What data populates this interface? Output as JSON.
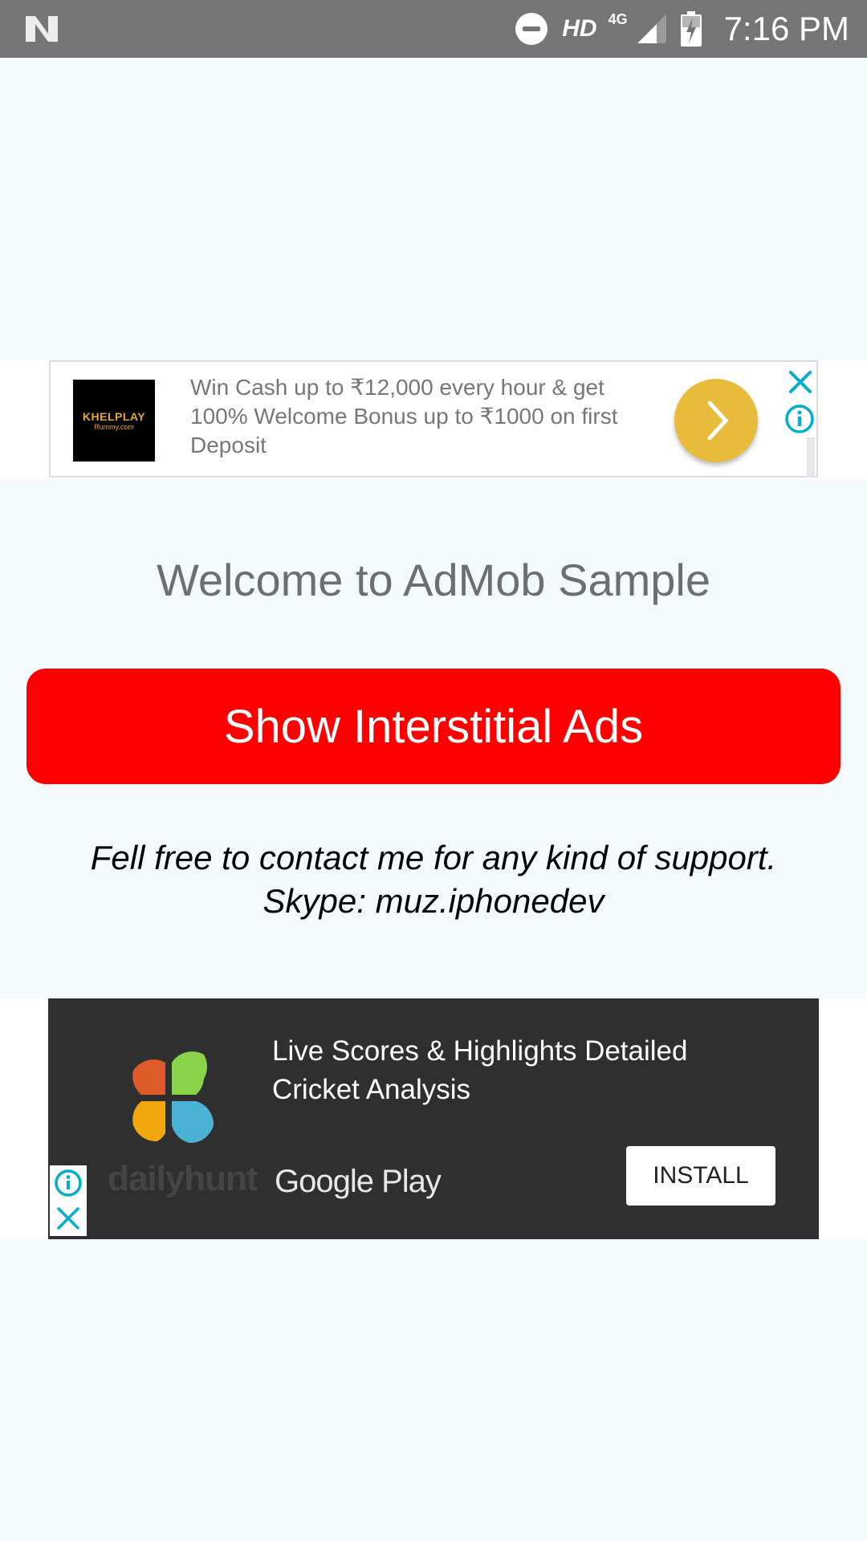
{
  "status_bar": {
    "time": "7:16 PM",
    "hd_label": "HD",
    "network_label": "4G",
    "icons": [
      "n-logo-icon",
      "do-not-disturb-icon",
      "signal-icon",
      "battery-charging-icon"
    ]
  },
  "banner_ad": {
    "logo_brand": "KHELPLAY",
    "logo_sub": "Rummy.com",
    "text": "Win Cash up to ₹12,000 every hour & get 100% Welcome Bonus up to ₹1000 on first Deposit",
    "cta_icon": "chevron-right-icon",
    "close_icon": "close-icon",
    "info_icon": "info-icon"
  },
  "main": {
    "welcome_text": "Welcome to AdMob Sample",
    "button_label": "Show Interstitial Ads",
    "support_line1": "Fell free to contact me for any kind of support.",
    "support_line2": "Skype: muz.iphonedev"
  },
  "native_ad": {
    "brand": "dailyhunt",
    "title": "Live Scores & Highlights Detailed Cricket Analysis",
    "store_label": "Google Play",
    "install_label": "INSTALL",
    "info_icon": "info-icon",
    "close_icon": "close-icon"
  },
  "colors": {
    "status_bar": "#757575",
    "background": "#f4f9fc",
    "button": "#ff0000",
    "ad_cta": "#e9bb3b",
    "ad_dark": "#2f2f2f",
    "adchoices": "#00aecd"
  }
}
